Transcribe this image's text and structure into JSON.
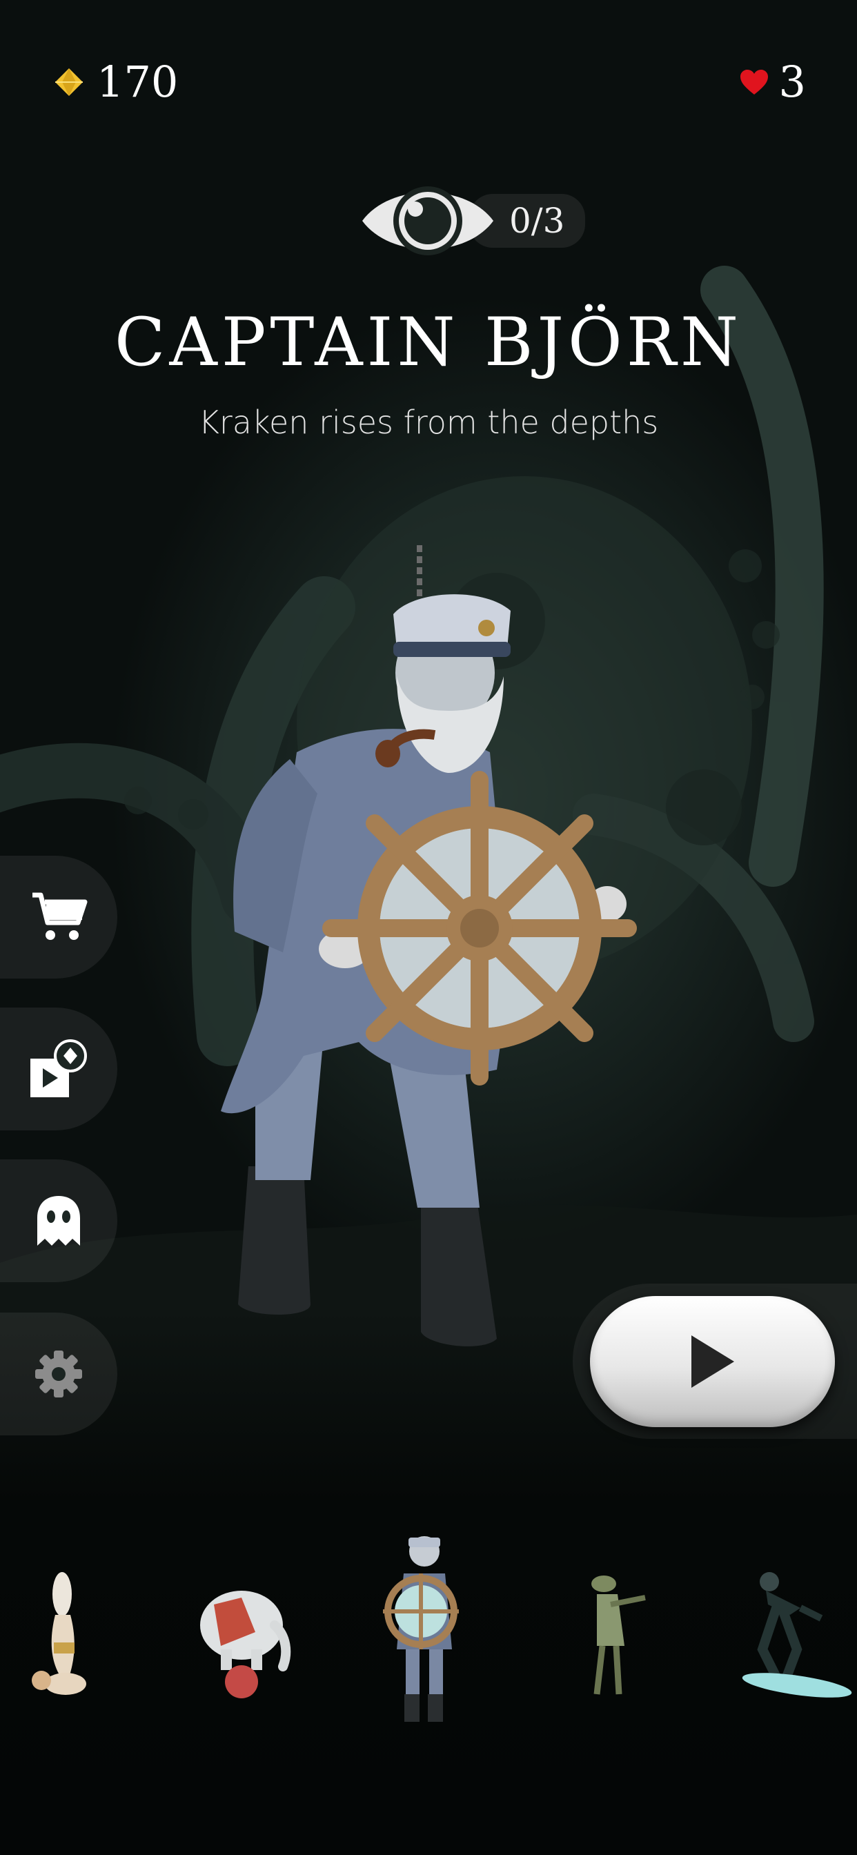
{
  "hud": {
    "gems": "170",
    "lives": "3"
  },
  "character": {
    "views": "0/3",
    "name": "CAPTAIN BJÖRN",
    "tagline": "Kraken rises from the depths"
  },
  "side_menu": [
    "cart-icon",
    "video-gem-icon",
    "ghost-icon",
    "gear-icon"
  ],
  "play": {
    "icon": "play-icon"
  },
  "character_strip": [
    "acrobat-figure",
    "circus-elephant-figure",
    "captain-bjorn-figure",
    "soldier-figure",
    "surfer-figure"
  ],
  "colors": {
    "gem": "#f2c230",
    "heart": "#e0141e",
    "background": "#17221f",
    "play_button": "#ececec"
  }
}
